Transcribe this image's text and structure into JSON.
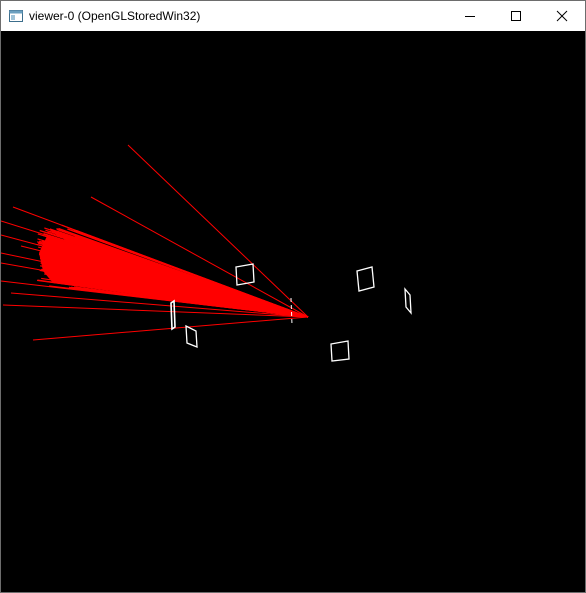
{
  "window": {
    "title": "viewer-0 (OpenGLStoredWin32)",
    "icon": "app-window-icon",
    "controls": [
      "minimize-icon",
      "maximize-icon",
      "close-icon"
    ]
  },
  "viewport": {
    "background": "#000000",
    "track_color": "#ff0000",
    "detector_color": "#ffffff"
  }
}
